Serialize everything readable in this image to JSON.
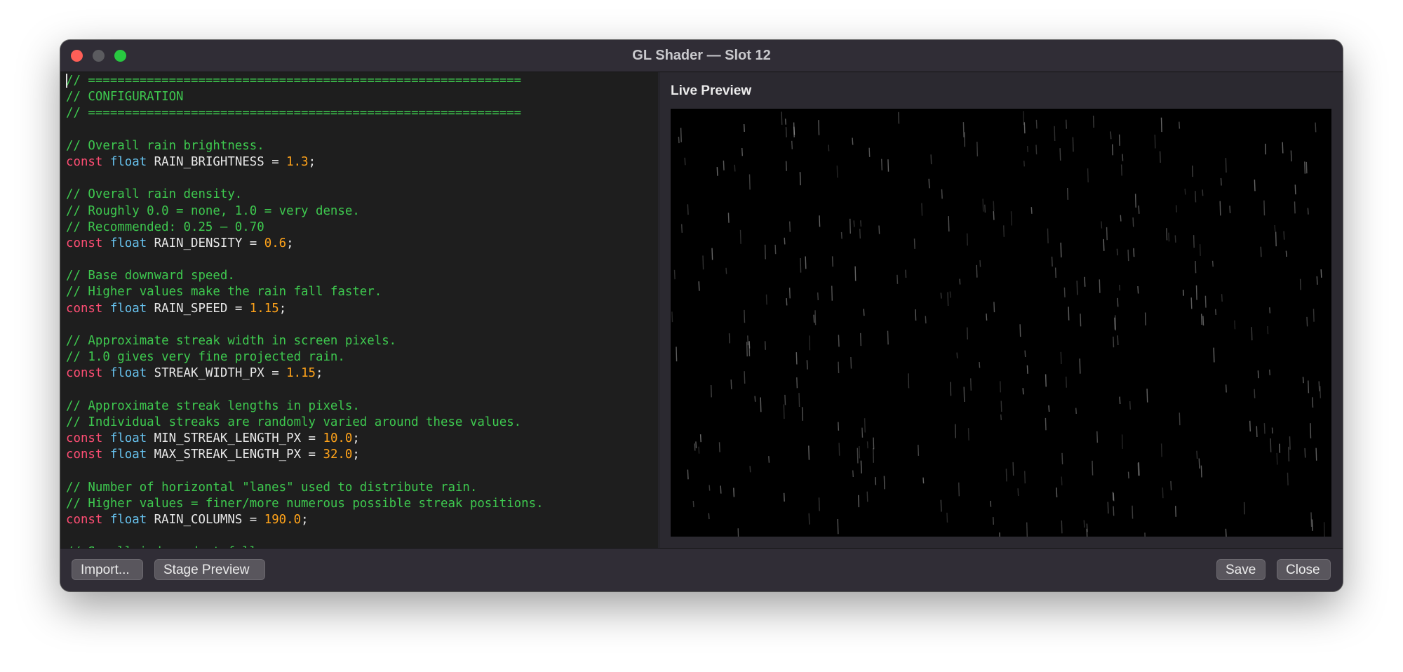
{
  "window": {
    "title": "GL Shader — Slot 12"
  },
  "editor": {
    "lines": [
      [
        {
          "t": "cm",
          "v": "// ==========================================================="
        }
      ],
      [
        {
          "t": "cm",
          "v": "// CONFIGURATION"
        }
      ],
      [
        {
          "t": "cm",
          "v": "// ==========================================================="
        }
      ],
      [],
      [
        {
          "t": "cm",
          "v": "// Overall rain brightness."
        }
      ],
      [
        {
          "t": "kw",
          "v": "const"
        },
        {
          "t": "op",
          "v": " "
        },
        {
          "t": "ty",
          "v": "float"
        },
        {
          "t": "id",
          "v": " RAIN_BRIGHTNESS = "
        },
        {
          "t": "num",
          "v": "1.3"
        },
        {
          "t": "op",
          "v": ";"
        }
      ],
      [],
      [
        {
          "t": "cm",
          "v": "// Overall rain density."
        }
      ],
      [
        {
          "t": "cm",
          "v": "// Roughly 0.0 = none, 1.0 = very dense."
        }
      ],
      [
        {
          "t": "cm",
          "v": "// Recommended: 0.25 – 0.70"
        }
      ],
      [
        {
          "t": "kw",
          "v": "const"
        },
        {
          "t": "op",
          "v": " "
        },
        {
          "t": "ty",
          "v": "float"
        },
        {
          "t": "id",
          "v": " RAIN_DENSITY = "
        },
        {
          "t": "num",
          "v": "0.6"
        },
        {
          "t": "op",
          "v": ";"
        }
      ],
      [],
      [
        {
          "t": "cm",
          "v": "// Base downward speed."
        }
      ],
      [
        {
          "t": "cm",
          "v": "// Higher values make the rain fall faster."
        }
      ],
      [
        {
          "t": "kw",
          "v": "const"
        },
        {
          "t": "op",
          "v": " "
        },
        {
          "t": "ty",
          "v": "float"
        },
        {
          "t": "id",
          "v": " RAIN_SPEED = "
        },
        {
          "t": "num",
          "v": "1.15"
        },
        {
          "t": "op",
          "v": ";"
        }
      ],
      [],
      [
        {
          "t": "cm",
          "v": "// Approximate streak width in screen pixels."
        }
      ],
      [
        {
          "t": "cm",
          "v": "// 1.0 gives very fine projected rain."
        }
      ],
      [
        {
          "t": "kw",
          "v": "const"
        },
        {
          "t": "op",
          "v": " "
        },
        {
          "t": "ty",
          "v": "float"
        },
        {
          "t": "id",
          "v": " STREAK_WIDTH_PX = "
        },
        {
          "t": "num",
          "v": "1.15"
        },
        {
          "t": "op",
          "v": ";"
        }
      ],
      [],
      [
        {
          "t": "cm",
          "v": "// Approximate streak lengths in pixels."
        }
      ],
      [
        {
          "t": "cm",
          "v": "// Individual streaks are randomly varied around these values."
        }
      ],
      [
        {
          "t": "kw",
          "v": "const"
        },
        {
          "t": "op",
          "v": " "
        },
        {
          "t": "ty",
          "v": "float"
        },
        {
          "t": "id",
          "v": " MIN_STREAK_LENGTH_PX = "
        },
        {
          "t": "num",
          "v": "10.0"
        },
        {
          "t": "op",
          "v": ";"
        }
      ],
      [
        {
          "t": "kw",
          "v": "const"
        },
        {
          "t": "op",
          "v": " "
        },
        {
          "t": "ty",
          "v": "float"
        },
        {
          "t": "id",
          "v": " MAX_STREAK_LENGTH_PX = "
        },
        {
          "t": "num",
          "v": "32.0"
        },
        {
          "t": "op",
          "v": ";"
        }
      ],
      [],
      [
        {
          "t": "cm",
          "v": "// Number of horizontal \"lanes\" used to distribute rain."
        }
      ],
      [
        {
          "t": "cm",
          "v": "// Higher values = finer/more numerous possible streak positions."
        }
      ],
      [
        {
          "t": "kw",
          "v": "const"
        },
        {
          "t": "op",
          "v": " "
        },
        {
          "t": "ty",
          "v": "float"
        },
        {
          "t": "id",
          "v": " RAIN_COLUMNS = "
        },
        {
          "t": "num",
          "v": "190.0"
        },
        {
          "t": "op",
          "v": ";"
        }
      ],
      [],
      [
        {
          "t": "cm",
          "v": "// Scroll-independent falls"
        }
      ]
    ]
  },
  "preview": {
    "title": "Live Preview"
  },
  "buttons": {
    "import": "Import...",
    "stage_preview": "Stage Preview",
    "save": "Save",
    "close": "Close"
  },
  "colors": {
    "comment": "#3ec94f",
    "keyword": "#ff4e74",
    "type": "#67c2ee",
    "number": "#ffa31a",
    "identifier": "#e8e8e8",
    "traffic_close": "#ff5f57",
    "traffic_minimize": "#5b5b5f",
    "traffic_maximize": "#28c840"
  }
}
